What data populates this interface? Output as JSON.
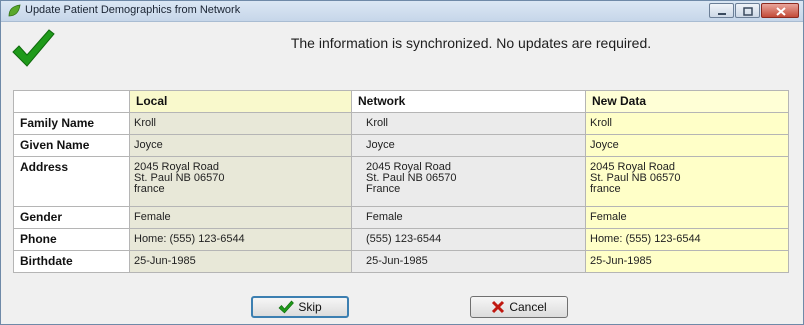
{
  "window": {
    "title": "Update Patient Demographics from Network",
    "colors": {
      "titlebar": "#c6d6e9",
      "close": "#c24a38"
    }
  },
  "message": "The information is synchronized.  No updates are required.",
  "status_icon": "green-check-icon",
  "table": {
    "headers": [
      "",
      "Local",
      "Network",
      "New Data"
    ],
    "rows": [
      {
        "label": "Family Name",
        "local": "Kroll",
        "network": "Kroll",
        "new": "Kroll"
      },
      {
        "label": "Given Name",
        "local": "Joyce",
        "network": "Joyce",
        "new": "Joyce"
      },
      {
        "label": "Address",
        "local": [
          "2045 Royal Road",
          "St. Paul NB  06570",
          "france"
        ],
        "network": [
          "2045 Royal Road",
          "St. Paul NB  06570",
          "France"
        ],
        "new": [
          "2045 Royal Road",
          "St. Paul NB  06570",
          "france"
        ]
      },
      {
        "label": "Gender",
        "local": "Female",
        "network": "Female",
        "new": "Female"
      },
      {
        "label": "Phone",
        "local": "Home: (555) 123-6544",
        "network": "(555) 123-6544",
        "new": "Home: (555) 123-6544"
      },
      {
        "label": "Birthdate",
        "local": "25-Jun-1985",
        "network": "25-Jun-1985",
        "new": "25-Jun-1985"
      }
    ],
    "colors": {
      "local": "#e8e8d8",
      "network": "#ebebeb",
      "new": "#ffffc8"
    }
  },
  "buttons": {
    "skip": {
      "label": "Skip",
      "icon": "check-icon"
    },
    "cancel": {
      "label": "Cancel",
      "icon": "red-x-icon"
    }
  }
}
